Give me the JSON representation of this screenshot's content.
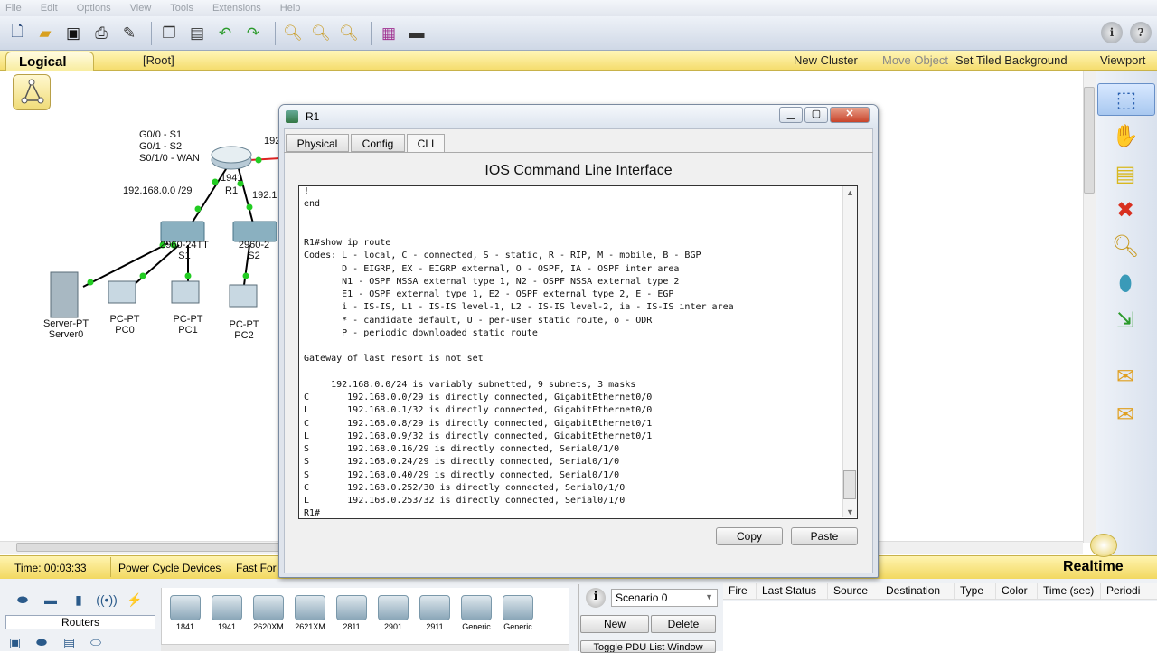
{
  "menu": [
    "File",
    "Edit",
    "Options",
    "View",
    "Tools",
    "Extensions",
    "Help"
  ],
  "toolbar": {
    "icons": [
      "new-file-icon",
      "open-folder-icon",
      "save-icon",
      "print-icon",
      "activity-wizard-icon",
      "copy-icon",
      "paste-icon",
      "undo-icon",
      "redo-icon",
      "zoom-in-icon",
      "zoom-reset-icon",
      "zoom-out-icon",
      "palette-icon",
      "custom-device-icon"
    ],
    "help": [
      "i",
      "?"
    ]
  },
  "workspace_bar": {
    "tab": "Logical",
    "root": "[Root]",
    "new_cluster": "New Cluster",
    "move_object": "Move Object",
    "set_bg": "Set Tiled Background",
    "viewport": "Viewport"
  },
  "topology": {
    "legend": [
      "G0/0 - S1",
      "G0/1 - S2",
      "S0/1/0 - WAN"
    ],
    "net_label_1": "192.168.0.0 /29",
    "r1_small": "1941",
    "r1_name": "R1",
    "ip_partial_1": "192.",
    "ip_partial_2": "192.1",
    "sw1_model": "2960-24TT",
    "sw1_name": "S1",
    "sw2_model": "2960-2",
    "sw2_name": "S2",
    "devices": [
      {
        "type": "Server-PT",
        "name": "Server0"
      },
      {
        "type": "PC-PT",
        "name": "PC0"
      },
      {
        "type": "PC-PT",
        "name": "PC1"
      },
      {
        "type": "PC-PT",
        "name": "PC2"
      }
    ],
    "colors": {
      "link": "#000000",
      "port_up": "#22cc22",
      "serial": "#dd2222"
    }
  },
  "window": {
    "title": "R1",
    "tabs": [
      "Physical",
      "Config",
      "CLI"
    ],
    "active_tab": "CLI",
    "heading": "IOS Command Line Interface",
    "terminal": "!\nend\n\n\nR1#show ip route\nCodes: L - local, C - connected, S - static, R - RIP, M - mobile, B - BGP\n       D - EIGRP, EX - EIGRP external, O - OSPF, IA - OSPF inter area\n       N1 - OSPF NSSA external type 1, N2 - OSPF NSSA external type 2\n       E1 - OSPF external type 1, E2 - OSPF external type 2, E - EGP\n       i - IS-IS, L1 - IS-IS level-1, L2 - IS-IS level-2, ia - IS-IS inter area\n       * - candidate default, U - per-user static route, o - ODR\n       P - periodic downloaded static route\n\nGateway of last resort is not set\n\n     192.168.0.0/24 is variably subnetted, 9 subnets, 3 masks\nC       192.168.0.0/29 is directly connected, GigabitEthernet0/0\nL       192.168.0.1/32 is directly connected, GigabitEthernet0/0\nC       192.168.0.8/29 is directly connected, GigabitEthernet0/1\nL       192.168.0.9/32 is directly connected, GigabitEthernet0/1\nS       192.168.0.16/29 is directly connected, Serial0/1/0\nS       192.168.0.24/29 is directly connected, Serial0/1/0\nS       192.168.0.40/29 is directly connected, Serial0/1/0\nC       192.168.0.252/30 is directly connected, Serial0/1/0\nL       192.168.0.253/32 is directly connected, Serial0/1/0\nR1#",
    "copy": "Copy",
    "paste": "Paste"
  },
  "status": {
    "time": "Time: 00:03:33",
    "power_cycle": "Power Cycle Devices",
    "fast_forward": "Fast For",
    "realtime": "Realtime"
  },
  "device_panel": {
    "category": "Routers",
    "models": [
      "1841",
      "1941",
      "2620XM",
      "2621XM",
      "2811",
      "2901",
      "2911",
      "Generic",
      "Generic"
    ]
  },
  "scenario": {
    "selected": "Scenario 0",
    "new": "New",
    "delete": "Delete",
    "toggle": "Toggle PDU List Window"
  },
  "pdu_columns": [
    "Fire",
    "Last Status",
    "Source",
    "Destination",
    "Type",
    "Color",
    "Time (sec)",
    "Periodi"
  ]
}
